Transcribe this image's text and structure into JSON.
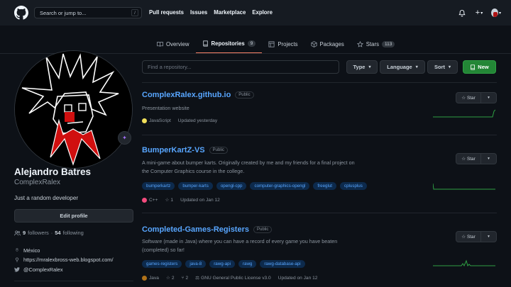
{
  "header": {
    "search_placeholder": "Search or jump to...",
    "search_shortcut": "/",
    "nav": [
      "Pull requests",
      "Issues",
      "Marketplace",
      "Explore"
    ],
    "icons": [
      "github-logo",
      "bell-icon",
      "plus-icon",
      "avatar"
    ]
  },
  "tabs": [
    {
      "label": "Overview",
      "icon": "book-icon"
    },
    {
      "label": "Repositories",
      "icon": "repo-icon",
      "count": "9",
      "active": true
    },
    {
      "label": "Projects",
      "icon": "table-icon"
    },
    {
      "label": "Packages",
      "icon": "package-icon"
    },
    {
      "label": "Stars",
      "icon": "star-icon",
      "count": "113"
    }
  ],
  "profile": {
    "name": "Alejandro Batres",
    "login": "ComplexRalex",
    "bio": "Just a random developer",
    "edit_label": "Edit profile",
    "followers": "9",
    "followers_label": "followers",
    "separator": "·",
    "following": "54",
    "following_label": "following",
    "location": "México",
    "website": "https://mralexbross-web.blogspot.com/",
    "twitter": "@ComplexRalex"
  },
  "filters": {
    "find_placeholder": "Find a repository...",
    "type_label": "Type",
    "language_label": "Language",
    "sort_label": "Sort",
    "new_label": "New"
  },
  "star_label": "Star",
  "colors": {
    "accent_link": "#58a6ff",
    "new_button": "#238636",
    "tab_underline": "#f78166",
    "sparkline": "#2ea043"
  },
  "repos": [
    {
      "name": "ComplexRalex.github.io",
      "visibility": "Public",
      "description": "Presentation website",
      "topics": [],
      "language": "JavaScript",
      "language_color": "#f1e05a",
      "stars": "",
      "forks": "",
      "license": "",
      "updated": "Updated yesterday"
    },
    {
      "name": "BumperKartZ-VS",
      "visibility": "Public",
      "description": "A mini-game about bumper karts. Originally created by me and my friends for a final project on the Computer Graphics course in the college.",
      "topics": [
        "bumperkartz",
        "bumper-karts",
        "opengl-cpp",
        "computer-graphics-opengl",
        "freeglut",
        "cplusplus"
      ],
      "language": "C++",
      "language_color": "#f34b7d",
      "stars": "1",
      "forks": "",
      "license": "",
      "updated": "Updated on Jan 12"
    },
    {
      "name": "Completed-Games-Registers",
      "visibility": "Public",
      "description": "Software (made in Java) where you can have a record of every game you have beaten (completed) so far!",
      "topics": [
        "games-registers",
        "java-8",
        "rawg-api",
        "rawg",
        "rawg-database-api"
      ],
      "language": "Java",
      "language_color": "#b07219",
      "stars": "2",
      "forks": "2",
      "license": "GNU General Public License v3.0",
      "updated": "Updated on Jan 12"
    }
  ]
}
